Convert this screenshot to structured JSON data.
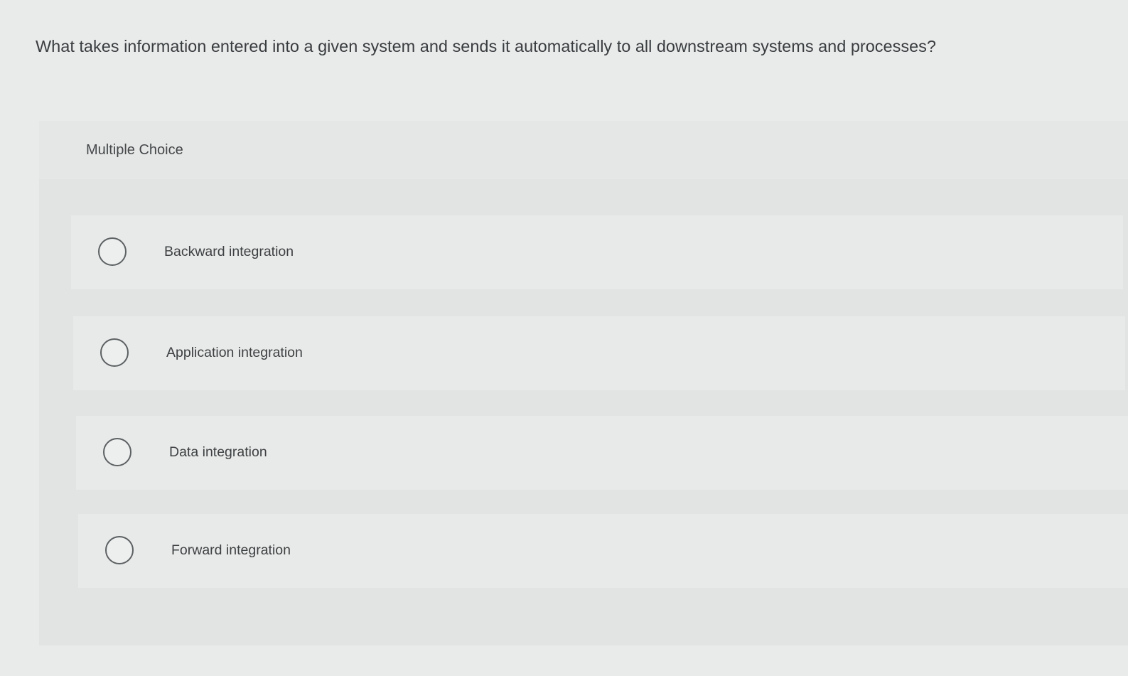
{
  "question": {
    "text": "What takes information entered into a given system and sends it automatically to all downstream systems and processes?"
  },
  "choices": {
    "type_label": "Multiple Choice",
    "options": [
      {
        "label": "Backward integration",
        "selected": false
      },
      {
        "label": "Application integration",
        "selected": false
      },
      {
        "label": "Data integration",
        "selected": false
      },
      {
        "label": "Forward integration",
        "selected": false
      }
    ]
  },
  "colors": {
    "background": "#e9ebea",
    "panel": "#e2e4e3",
    "text": "#3f4244",
    "radio_border": "#5d6163"
  }
}
